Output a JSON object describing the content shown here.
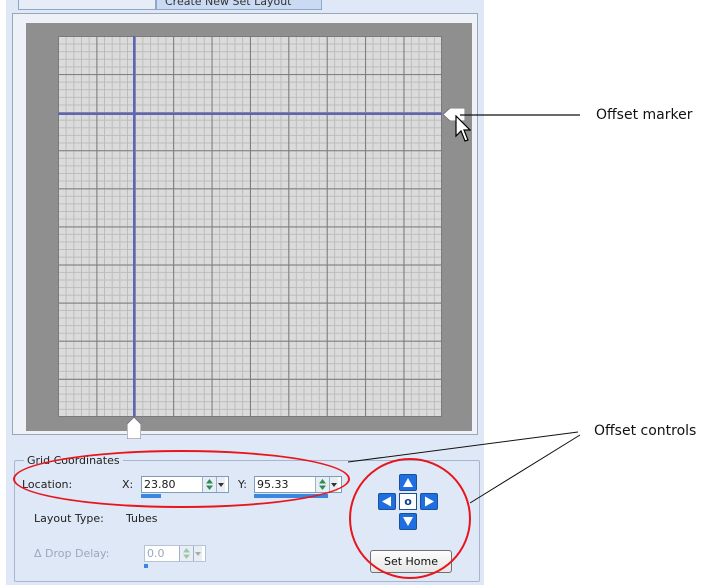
{
  "tabs": {
    "first_label": "",
    "active_label": "Create New Set Layout"
  },
  "grid": {
    "x_value": 23.8,
    "y_value": 95.33
  },
  "group": {
    "title": "Grid Coordinates",
    "location_label": "Location:",
    "x_label": "X:",
    "x_value": "23.80",
    "y_label": "Y:",
    "y_value": "95.33",
    "layout_type_label": "Layout Type:",
    "layout_type_value": "Tubes",
    "drop_delay_label": "Δ Drop Delay:",
    "drop_delay_value": "0.0"
  },
  "offset": {
    "home_symbol": "o",
    "set_home_label": "Set Home",
    "icons": [
      "arrow-up-icon",
      "arrow-down-icon",
      "arrow-left-icon",
      "arrow-right-icon",
      "home-icon"
    ]
  },
  "callouts": {
    "offset_marker": "Offset marker",
    "offset_controls": "Offset controls"
  },
  "colors": {
    "panel": "#dfe8f6",
    "grid_background": "#8f8f8f",
    "crosshair": "#5b63c7",
    "arrow_button": "#1f6fe0",
    "highlight_ring": "#e8161c"
  }
}
